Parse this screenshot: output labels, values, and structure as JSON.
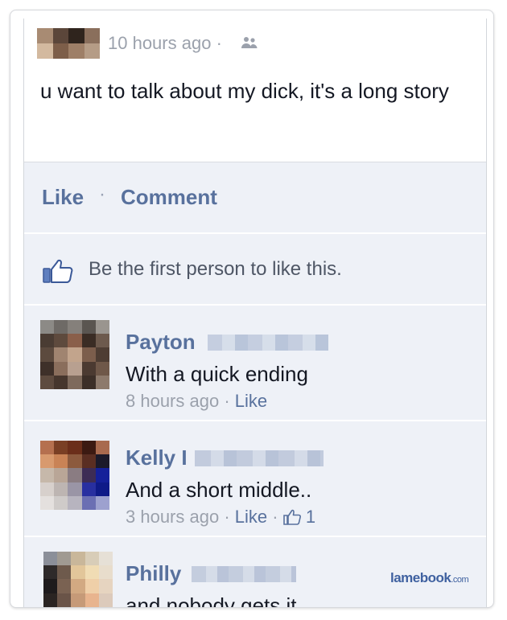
{
  "post": {
    "time": "10 hours ago",
    "audience_sep": "·",
    "audience_icon": "friends-icon",
    "text": "u want to talk about my dick, it's a long story"
  },
  "actions": {
    "like": "Like",
    "sep": "·",
    "comment": "Comment"
  },
  "likes": {
    "icon": "thumbs-up-icon",
    "text": "Be the first person to like this."
  },
  "comments": [
    {
      "name": "Payton",
      "text": "With a quick ending",
      "time": "8 hours ago",
      "sep": "·",
      "like": "Like"
    },
    {
      "name": "Kelly",
      "name_suffix": "I",
      "text": "And a short middle..",
      "time": "3 hours ago",
      "sep": "·",
      "like": "Like",
      "sep2": "·",
      "like_count": "1"
    },
    {
      "name": "Philly",
      "text": "and nobody gets it"
    }
  ],
  "watermark": {
    "brand": "lamebook",
    "tld": ".com"
  },
  "colors": {
    "link": "#58719d",
    "panel": "#eef1f7",
    "meta": "#9ba1ac"
  }
}
